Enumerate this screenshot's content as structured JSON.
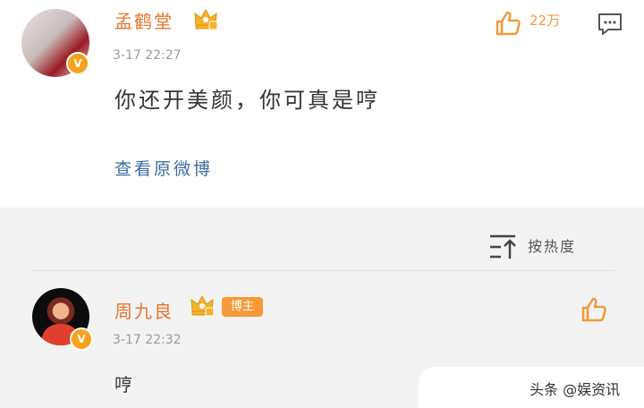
{
  "comment": {
    "username": "孟鹤堂",
    "timestamp": "3-17 22:27",
    "text": "你还开美颜，你可真是哼",
    "like_count": "22万",
    "view_original_link": "查看原微博",
    "like_icon": "thumbs-up-icon",
    "reply_icon": "comment-icon"
  },
  "sort": {
    "label": "按热度",
    "icon": "sort-icon"
  },
  "reply": {
    "username": "周九良",
    "badge": "博主",
    "timestamp": "3-17 22:32",
    "text": "哼",
    "like_icon": "thumbs-up-icon"
  },
  "watermark": {
    "text": "头条 @娱资讯"
  },
  "colors": {
    "username": "#e8742a",
    "link": "#3d6e9e",
    "accent": "#f59a38",
    "verified": "#f7a21b"
  }
}
